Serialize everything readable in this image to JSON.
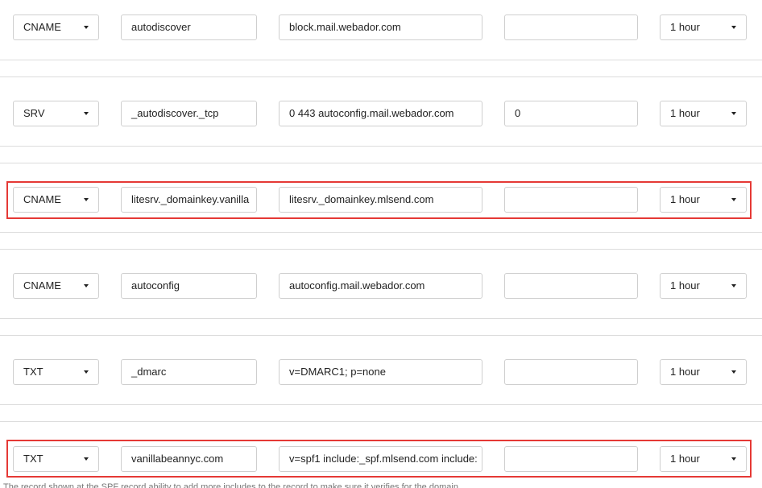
{
  "rows": [
    {
      "type": "CNAME",
      "host": "autodiscover",
      "target": "block.mail.webador.com",
      "priority": "",
      "ttl": "1 hour",
      "highlighted": false
    },
    {
      "type": "SRV",
      "host": "_autodiscover._tcp",
      "target": "0 443 autoconfig.mail.webador.com",
      "priority": "0",
      "ttl": "1 hour",
      "highlighted": false
    },
    {
      "type": "CNAME",
      "host": "litesrv._domainkey.vanilla",
      "target": "litesrv._domainkey.mlsend.com",
      "priority": "",
      "ttl": "1 hour",
      "highlighted": true
    },
    {
      "type": "CNAME",
      "host": "autoconfig",
      "target": "autoconfig.mail.webador.com",
      "priority": "",
      "ttl": "1 hour",
      "highlighted": false
    },
    {
      "type": "TXT",
      "host": "_dmarc",
      "target": "v=DMARC1; p=none",
      "priority": "",
      "ttl": "1 hour",
      "highlighted": false
    },
    {
      "type": "TXT",
      "host": "vanillabeannyc.com",
      "target": "v=spf1 include:_spf.mlsend.com include:",
      "priority": "",
      "ttl": "1 hour",
      "highlighted": true
    }
  ],
  "footnote": "The record shown at the SPF record ability to add more includes to the record to make sure it verifies for the domain"
}
